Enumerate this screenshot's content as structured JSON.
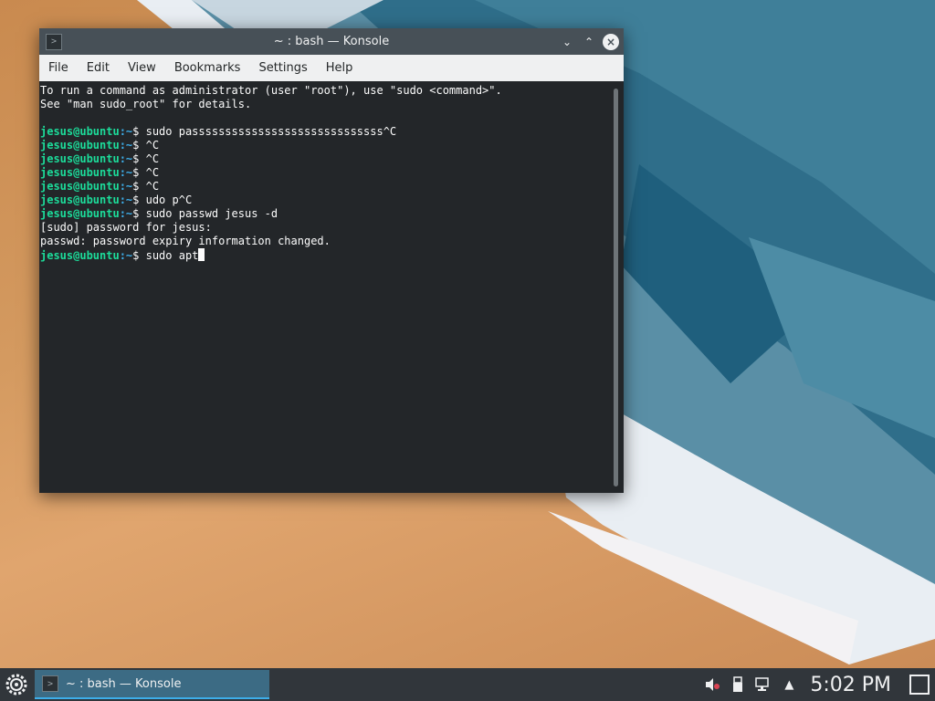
{
  "window": {
    "title": "~ : bash — Konsole",
    "menu": [
      "File",
      "Edit",
      "View",
      "Bookmarks",
      "Settings",
      "Help"
    ]
  },
  "terminal": {
    "lines": [
      {
        "type": "text",
        "text": "To run a command as administrator (user \"root\"), use \"sudo <command>\"."
      },
      {
        "type": "text",
        "text": "See \"man sudo_root\" for details."
      },
      {
        "type": "text",
        "text": ""
      },
      {
        "type": "prompt",
        "user": "jesus@ubuntu",
        "path": ":~",
        "cmd": "$ sudo passsssssssssssssssssssssssssss^C"
      },
      {
        "type": "prompt",
        "user": "jesus@ubuntu",
        "path": ":~",
        "cmd": "$ ^C"
      },
      {
        "type": "prompt",
        "user": "jesus@ubuntu",
        "path": ":~",
        "cmd": "$ ^C"
      },
      {
        "type": "prompt",
        "user": "jesus@ubuntu",
        "path": ":~",
        "cmd": "$ ^C"
      },
      {
        "type": "prompt",
        "user": "jesus@ubuntu",
        "path": ":~",
        "cmd": "$ ^C"
      },
      {
        "type": "prompt",
        "user": "jesus@ubuntu",
        "path": ":~",
        "cmd": "$ udo p^C"
      },
      {
        "type": "prompt",
        "user": "jesus@ubuntu",
        "path": ":~",
        "cmd": "$ sudo passwd jesus -d"
      },
      {
        "type": "text",
        "text": "[sudo] password for jesus:"
      },
      {
        "type": "text",
        "text": "passwd: password expiry information changed."
      },
      {
        "type": "prompt",
        "user": "jesus@ubuntu",
        "path": ":~",
        "cmd": "$ sudo apt",
        "cursor": true
      }
    ]
  },
  "taskbar": {
    "task_label": "~ : bash — Konsole",
    "clock": "5:02 PM"
  },
  "colors": {
    "terminal_bg": "#232629",
    "prompt_user": "#1cdc9a",
    "prompt_path": "#3daee9",
    "titlebar": "#475057",
    "taskbar": "#31363b",
    "task_active": "#3c6b84"
  },
  "icons": {
    "app": "terminal-icon",
    "minimize": "chevron-down-icon",
    "maximize": "chevron-up-icon",
    "close": "close-icon",
    "kicker": "gear-icon",
    "volume": "volume-muted-icon",
    "usb": "usb-device-icon",
    "network": "network-icon",
    "tray_expand": "triangle-up-icon",
    "show_desktop": "show-desktop-icon"
  }
}
